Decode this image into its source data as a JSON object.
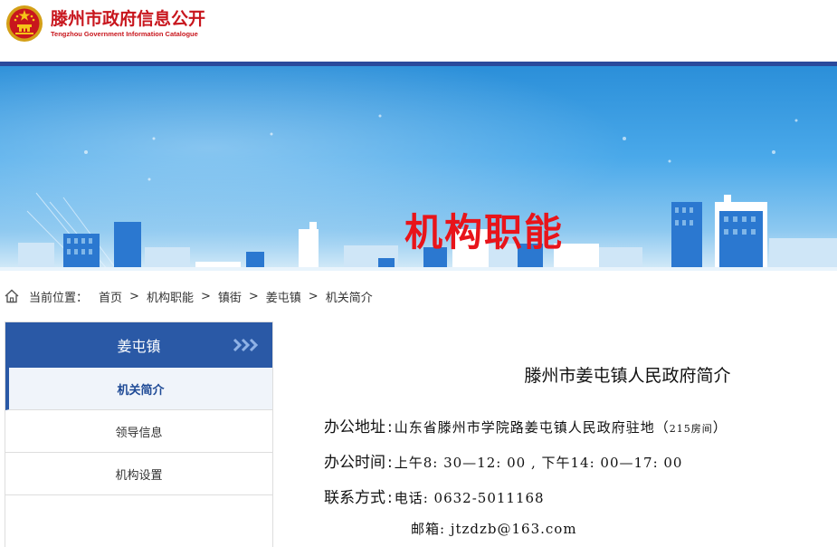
{
  "site": {
    "title": "滕州市政府信息公开",
    "subtitle": "Tengzhou Government Information Catalogue"
  },
  "banner": {
    "title": "机构职能"
  },
  "breadcrumb": {
    "label": "当前位置：",
    "items": [
      "首页",
      "机构职能",
      "镇街",
      "姜屯镇",
      "机关简介"
    ],
    "separator": ">"
  },
  "sidebar": {
    "heading": "姜屯镇",
    "items": [
      {
        "label": "机关简介",
        "active": true
      },
      {
        "label": "领导信息",
        "active": false
      },
      {
        "label": "机构设置",
        "active": false
      }
    ]
  },
  "article": {
    "title": "滕州市姜屯镇人民政府简介",
    "rows": [
      {
        "key": "办公地址",
        "value": "山东省滕州市学院路姜屯镇人民政府驻地（",
        "value_suffix": "215房间",
        "value_end": "）"
      },
      {
        "key": "办公时间",
        "value": "上午8: 30—12: 00 , 下午14: 00—17: 00"
      },
      {
        "key": "联系方式",
        "value": "电话: 0632-5011168"
      },
      {
        "key": "",
        "value": "邮箱: jtzdzb@163.com"
      }
    ]
  },
  "colors": {
    "brand_red": "#c8161d",
    "banner_title_red": "#e8141a",
    "nav_blue": "#2a59a6"
  }
}
